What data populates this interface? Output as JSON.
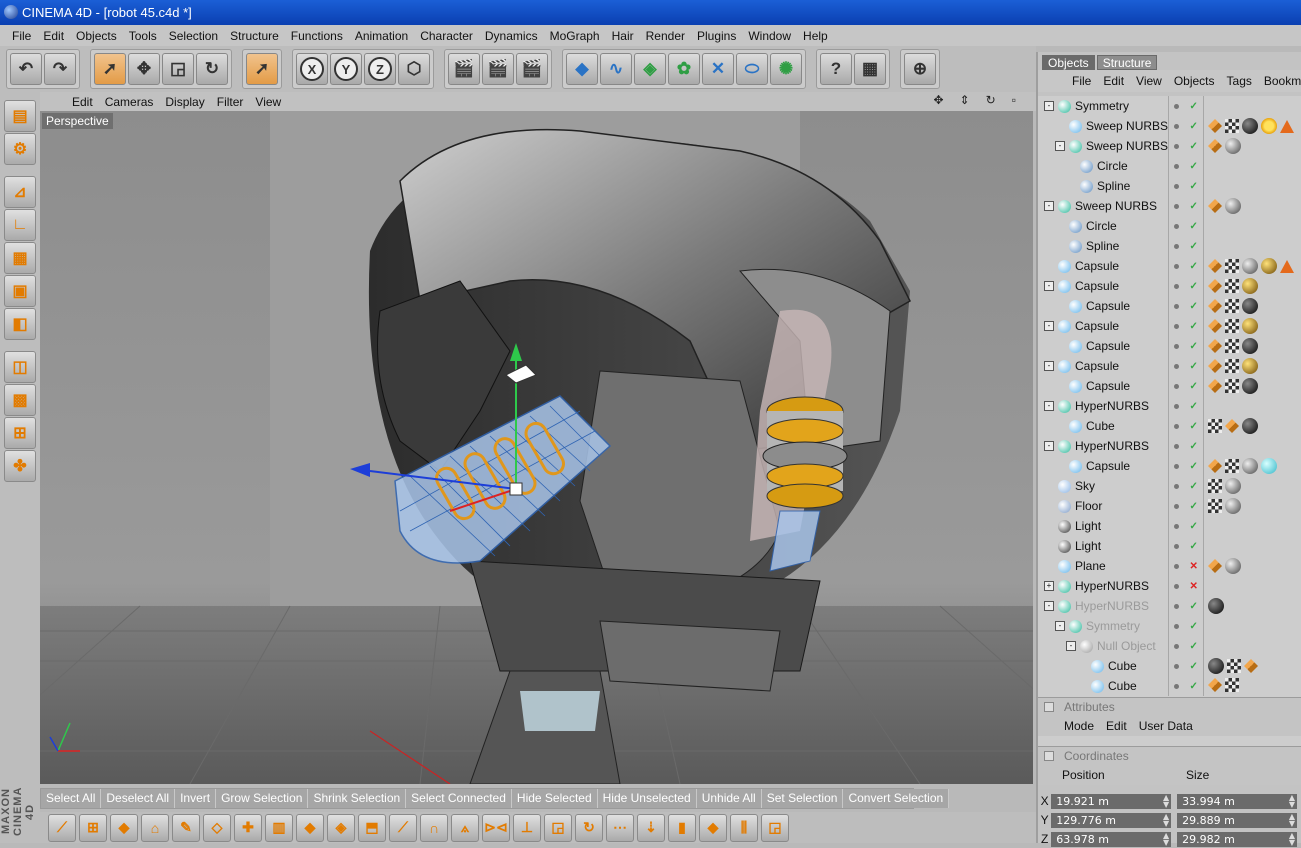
{
  "window": {
    "title": "CINEMA 4D - [robot 45.c4d *]"
  },
  "menubar": [
    "File",
    "Edit",
    "Objects",
    "Tools",
    "Selection",
    "Structure",
    "Functions",
    "Animation",
    "Character",
    "Dynamics",
    "MoGraph",
    "Hair",
    "Render",
    "Plugins",
    "Window",
    "Help"
  ],
  "toolbar": {
    "groups": [
      [
        {
          "icon": "undo-icon",
          "glyph": "↶"
        },
        {
          "icon": "redo-icon",
          "glyph": "↷"
        }
      ],
      [
        {
          "icon": "live-selection-icon",
          "glyph": "➚",
          "active": true
        },
        {
          "icon": "move-icon",
          "glyph": "✥"
        },
        {
          "icon": "scale-icon",
          "glyph": "◲"
        },
        {
          "icon": "rotate-icon",
          "glyph": "↻"
        }
      ],
      [
        {
          "icon": "recent-tool-icon",
          "glyph": "➚",
          "active": true
        }
      ],
      [
        {
          "icon": "x-axis-icon",
          "glyph": "X",
          "round": true
        },
        {
          "icon": "y-axis-icon",
          "glyph": "Y",
          "round": true
        },
        {
          "icon": "z-axis-icon",
          "glyph": "Z",
          "round": true
        },
        {
          "icon": "coordinate-system-icon",
          "glyph": "⬡"
        }
      ],
      [
        {
          "icon": "render-view-icon",
          "glyph": "🎬"
        },
        {
          "icon": "render-picture-viewer-icon",
          "glyph": "🎬"
        },
        {
          "icon": "render-settings-icon",
          "glyph": "🎬"
        }
      ],
      [
        {
          "icon": "cube-primitive-icon",
          "glyph": "◆",
          "color": "blue"
        },
        {
          "icon": "spline-pen-icon",
          "glyph": "∿",
          "color": "blue"
        },
        {
          "icon": "nurbs-icon",
          "glyph": "◈",
          "color": "green"
        },
        {
          "icon": "array-icon",
          "glyph": "✿",
          "color": "green"
        },
        {
          "icon": "deformer-icon",
          "glyph": "✕",
          "color": "blue"
        },
        {
          "icon": "scene-floor-icon",
          "glyph": "⬭",
          "color": "blue"
        },
        {
          "icon": "light-icon",
          "glyph": "✺",
          "color": "green"
        }
      ],
      [
        {
          "icon": "help-pointer-icon",
          "glyph": "?"
        },
        {
          "icon": "timeline-icon",
          "glyph": "▦"
        }
      ],
      [
        {
          "icon": "browser-icon",
          "glyph": "⊕"
        }
      ]
    ]
  },
  "left_tools": [
    {
      "icon": "model-mode-icon",
      "glyph": "▤"
    },
    {
      "icon": "object-axis-icon",
      "glyph": "⚙"
    },
    {
      "icon": "points-mode-icon",
      "glyph": "⊿"
    },
    {
      "icon": "edges-mode-icon",
      "glyph": "∟"
    },
    {
      "icon": "polygons-mode-icon",
      "glyph": "▦"
    },
    {
      "icon": "uv-points-icon",
      "glyph": "▣"
    },
    {
      "icon": "uv-polygons-icon",
      "glyph": "◧"
    },
    {
      "icon": "object-mode-icon",
      "glyph": "◫"
    },
    {
      "icon": "texture-mode-icon",
      "glyph": "▩"
    },
    {
      "icon": "axis-mode-icon",
      "glyph": "⊞"
    },
    {
      "icon": "tweak-mode-icon",
      "glyph": "✤"
    }
  ],
  "brand_vertical": "MAXON CINEMA 4D",
  "viewport": {
    "menu": [
      "Edit",
      "Cameras",
      "Display",
      "Filter",
      "View"
    ],
    "nav_icons": [
      "✥",
      "⇕",
      "↻",
      "▫"
    ],
    "label": "Perspective"
  },
  "selection_bar": [
    "Select All",
    "Deselect All",
    "Invert",
    "Grow Selection",
    "Shrink Selection",
    "Select Connected",
    "Hide Selected",
    "Hide Unselected",
    "Unhide All",
    "Set Selection",
    "Convert Selection"
  ],
  "bottom_tools": [
    "⟋",
    "⊞",
    "◆",
    "⌂",
    "✎",
    "◇",
    "✚",
    "▥",
    "◆",
    "◈",
    "⬒",
    "⟋",
    "∩",
    "⟑",
    "⊳⊲",
    "⊥",
    "◲",
    "↻",
    "⋯",
    "⇣",
    "▮",
    "◆",
    "⫼",
    "◲"
  ],
  "objects_panel": {
    "tabs": [
      {
        "label": "Objects",
        "active": true
      },
      {
        "label": "Structure",
        "active": false
      }
    ],
    "menu": [
      "File",
      "Edit",
      "View",
      "Objects",
      "Tags",
      "Bookmarks"
    ],
    "rows": [
      {
        "name": "Symmetry",
        "depth": 0,
        "expander": "-",
        "icon": "#2ab89a",
        "vis": "dot-chk",
        "tags": []
      },
      {
        "name": "Sweep NURBS",
        "depth": 1,
        "expander": "",
        "icon": "#62b4ea",
        "vis": "dot-chk",
        "tags": [
          "phong",
          "uv",
          "mat-black",
          "sun",
          "tri"
        ]
      },
      {
        "name": "Sweep NURBS",
        "depth": 1,
        "expander": "-",
        "icon": "#2ab89a",
        "vis": "dot-chk",
        "tags": [
          "phong",
          "mat-grey"
        ]
      },
      {
        "name": "Circle",
        "depth": 2,
        "expander": "",
        "icon": "#5b8cc0",
        "vis": "dot-chk",
        "tags": []
      },
      {
        "name": "Spline",
        "depth": 2,
        "expander": "",
        "icon": "#5b8cc0",
        "vis": "dot-chk",
        "tags": []
      },
      {
        "name": "Sweep NURBS",
        "depth": 0,
        "expander": "-",
        "icon": "#2ab89a",
        "vis": "dot-chk",
        "tags": [
          "phong",
          "mat-grey"
        ]
      },
      {
        "name": "Circle",
        "depth": 1,
        "expander": "",
        "icon": "#5b8cc0",
        "vis": "dot-chk",
        "tags": []
      },
      {
        "name": "Spline",
        "depth": 1,
        "expander": "",
        "icon": "#5b8cc0",
        "vis": "dot-chk",
        "tags": []
      },
      {
        "name": "Capsule",
        "depth": 0,
        "expander": "",
        "icon": "#62b4ea",
        "vis": "dot-chk",
        "tags": [
          "phong",
          "uv",
          "mat-grey",
          "mat-gold",
          "tri"
        ]
      },
      {
        "name": "Capsule",
        "depth": 0,
        "expander": "-",
        "icon": "#62b4ea",
        "vis": "dot-chk",
        "tags": [
          "phong",
          "uv",
          "mat-gold"
        ]
      },
      {
        "name": "Capsule",
        "depth": 1,
        "expander": "",
        "icon": "#62b4ea",
        "vis": "dot-chk",
        "tags": [
          "phong",
          "uv",
          "mat-black"
        ]
      },
      {
        "name": "Capsule",
        "depth": 0,
        "expander": "-",
        "icon": "#62b4ea",
        "vis": "dot-chk",
        "tags": [
          "phong",
          "uv",
          "mat-gold"
        ]
      },
      {
        "name": "Capsule",
        "depth": 1,
        "expander": "",
        "icon": "#62b4ea",
        "vis": "dot-chk",
        "tags": [
          "phong",
          "uv",
          "mat-black"
        ]
      },
      {
        "name": "Capsule",
        "depth": 0,
        "expander": "-",
        "icon": "#62b4ea",
        "vis": "dot-chk",
        "tags": [
          "phong",
          "uv",
          "mat-gold"
        ]
      },
      {
        "name": "Capsule",
        "depth": 1,
        "expander": "",
        "icon": "#62b4ea",
        "vis": "dot-chk",
        "tags": [
          "phong",
          "uv",
          "mat-black"
        ]
      },
      {
        "name": "HyperNURBS",
        "depth": 0,
        "expander": "-",
        "icon": "#2ab89a",
        "vis": "dot-chk",
        "tags": []
      },
      {
        "name": "Cube",
        "depth": 1,
        "expander": "",
        "icon": "#62b4ea",
        "vis": "dot-chk",
        "tags": [
          "uv",
          "phong",
          "mat-black"
        ]
      },
      {
        "name": "HyperNURBS",
        "depth": 0,
        "expander": "-",
        "icon": "#2ab89a",
        "vis": "dot-chk",
        "tags": []
      },
      {
        "name": "Capsule",
        "depth": 1,
        "expander": "",
        "icon": "#62b4ea",
        "vis": "dot-chk",
        "tags": [
          "phong",
          "uv",
          "mat-grey",
          "mat-cyan"
        ]
      },
      {
        "name": "Sky",
        "depth": 0,
        "expander": "",
        "icon": "#8ab4e4",
        "vis": "dot-chk",
        "tags": [
          "uv",
          "mat-grey"
        ]
      },
      {
        "name": "Floor",
        "depth": 0,
        "expander": "",
        "icon": "#7d9cc7",
        "vis": "dot-chk",
        "tags": [
          "uv",
          "mat-grey"
        ]
      },
      {
        "name": "Light",
        "depth": 0,
        "expander": "",
        "icon": "#333333",
        "vis": "dot-chk",
        "tags": []
      },
      {
        "name": "Light",
        "depth": 0,
        "expander": "",
        "icon": "#333333",
        "vis": "dot-chk",
        "tags": []
      },
      {
        "name": "Plane",
        "depth": 0,
        "expander": "",
        "icon": "#62b4ea",
        "vis": "dot-x",
        "tags": [
          "phong",
          "mat-grey"
        ]
      },
      {
        "name": "HyperNURBS",
        "depth": 0,
        "expander": "+",
        "icon": "#2ab89a",
        "vis": "dot-x",
        "tags": []
      },
      {
        "name": "HyperNURBS",
        "depth": 0,
        "expander": "-",
        "icon": "#2ab89a",
        "vis": "dot-chk",
        "tags": [
          "mat-black"
        ],
        "disabled": true
      },
      {
        "name": "Symmetry",
        "depth": 1,
        "expander": "-",
        "icon": "#2ab89a",
        "vis": "dot-chk",
        "tags": [],
        "disabled": true
      },
      {
        "name": "Null Object",
        "depth": 2,
        "expander": "-",
        "icon": "#999999",
        "vis": "dot-chk",
        "tags": [],
        "disabled": true
      },
      {
        "name": "Cube",
        "depth": 3,
        "expander": "",
        "icon": "#62b4ea",
        "vis": "dot-chk",
        "tags": [
          "mat-black",
          "uv",
          "phong"
        ]
      },
      {
        "name": "Cube",
        "depth": 3,
        "expander": "",
        "icon": "#62b4ea",
        "vis": "dot-chk",
        "tags": [
          "phong",
          "uv"
        ]
      }
    ]
  },
  "attributes": {
    "title": "Attributes",
    "menu": [
      "Mode",
      "Edit",
      "User Data"
    ]
  },
  "coordinates": {
    "title": "Coordinates",
    "position_label": "Position",
    "size_label": "Size",
    "rows": [
      {
        "axis": "X",
        "position": "19.921 m",
        "size": "33.994 m"
      },
      {
        "axis": "Y",
        "position": "129.776 m",
        "size": "29.889 m"
      },
      {
        "axis": "Z",
        "position": "63.978 m",
        "size": "29.982 m"
      }
    ]
  }
}
